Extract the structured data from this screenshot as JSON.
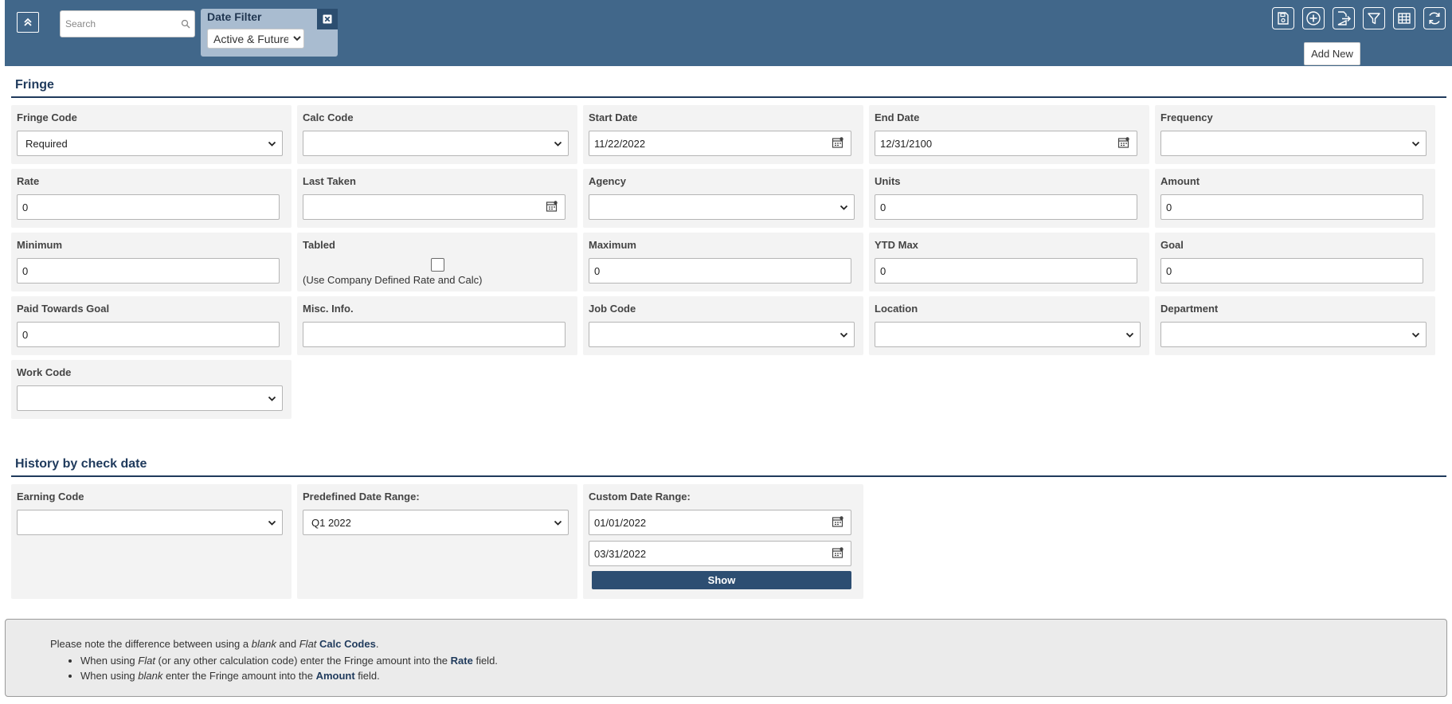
{
  "toolbar": {
    "search_placeholder": "Search",
    "date_filter_label": "Date Filter",
    "date_filter_value": "Active & Future",
    "icons": [
      "save-icon",
      "add-icon",
      "export-icon",
      "filter-icon",
      "grid-icon",
      "refresh-icon"
    ],
    "tooltip": "Add New",
    "bg_color": "#41678a"
  },
  "fringe": {
    "title": "Fringe",
    "fringe_code": {
      "label": "Fringe Code",
      "value": "Required"
    },
    "calc_code": {
      "label": "Calc Code",
      "value": ""
    },
    "start_date": {
      "label": "Start Date",
      "value": "11/22/2022"
    },
    "end_date": {
      "label": "End Date",
      "value": "12/31/2100"
    },
    "frequency": {
      "label": "Frequency",
      "value": ""
    },
    "rate": {
      "label": "Rate",
      "value": "0"
    },
    "last_taken": {
      "label": "Last Taken",
      "value": ""
    },
    "agency": {
      "label": "Agency",
      "value": ""
    },
    "units": {
      "label": "Units",
      "value": "0"
    },
    "amount": {
      "label": "Amount",
      "value": "0"
    },
    "minimum": {
      "label": "Minimum",
      "value": "0"
    },
    "tabled": {
      "label": "Tabled",
      "note": "(Use Company Defined Rate and Calc)"
    },
    "maximum": {
      "label": "Maximum",
      "value": "0"
    },
    "ytd_max": {
      "label": "YTD Max",
      "value": "0"
    },
    "goal": {
      "label": "Goal",
      "value": "0"
    },
    "paid_towards_goal": {
      "label": "Paid Towards Goal",
      "value": "0"
    },
    "misc_info": {
      "label": "Misc. Info.",
      "value": ""
    },
    "job_code": {
      "label": "Job Code",
      "value": ""
    },
    "location": {
      "label": "Location",
      "value": ""
    },
    "department": {
      "label": "Department",
      "value": ""
    },
    "work_code": {
      "label": "Work Code",
      "value": ""
    }
  },
  "history": {
    "title": "History by check date",
    "earning_code": {
      "label": "Earning Code",
      "value": ""
    },
    "predefined_range": {
      "label": "Predefined Date Range:",
      "value": "Q1 2022"
    },
    "custom_range": {
      "label": "Custom Date Range:",
      "from": "01/01/2022",
      "to": "03/31/2022"
    },
    "show_label": "Show"
  },
  "note": {
    "intro_pre": "Please note the difference between using a ",
    "intro_blank": "blank",
    "intro_and": " and ",
    "intro_flat": "Flat",
    "intro_space": " ",
    "intro_calc_codes": "Calc Codes",
    "intro_end": ".",
    "b1_pre": "When using ",
    "b1_flat": "Flat",
    "b1_mid": " (or any other calculation code) enter the Fringe amount into the ",
    "b1_rate": "Rate",
    "b1_end": " field.",
    "b2_pre": "When using ",
    "b2_blank": "blank",
    "b2_mid": " enter the Fringe amount into the ",
    "b2_amount": "Amount",
    "b2_end": " field."
  }
}
